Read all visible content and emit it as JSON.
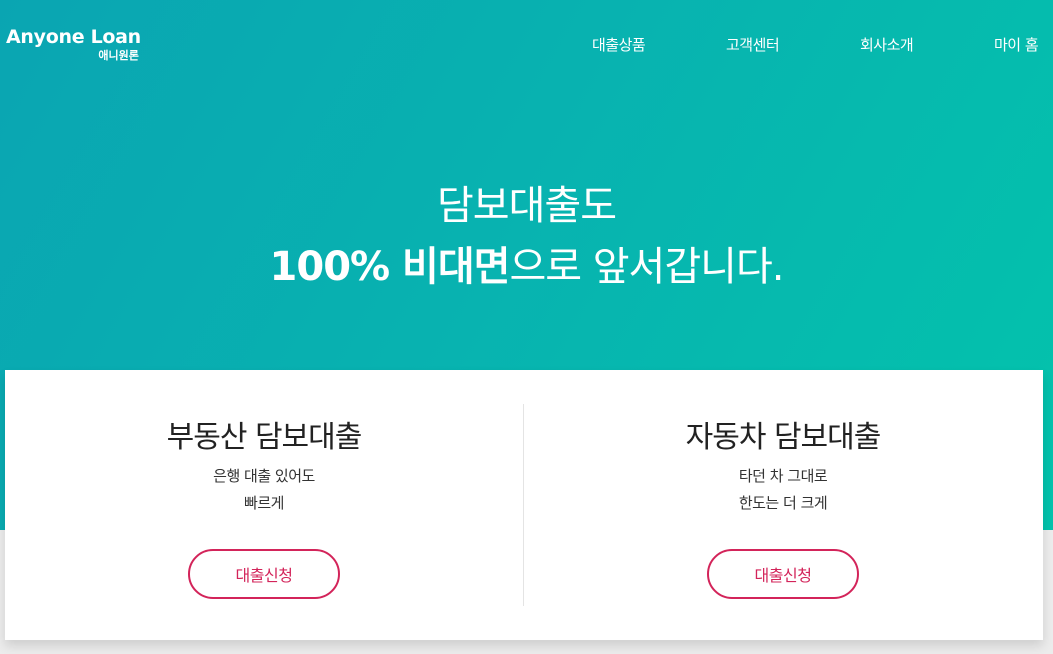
{
  "logo": {
    "name_en": "Anyone Loan",
    "name_ko": "애니원론"
  },
  "nav": {
    "items": [
      {
        "label": "대출상품"
      },
      {
        "label": "고객센터"
      },
      {
        "label": "회사소개"
      },
      {
        "label": "마이 홈"
      }
    ]
  },
  "hero": {
    "line1": "담보대출도",
    "line2_strong": "100% 비대면",
    "line2_rest": "으로 앞서갑니다."
  },
  "products": [
    {
      "title": "부동산 담보대출",
      "desc_line1": "은행 대출 있어도",
      "desc_line2": "빠르게",
      "button": "대출신청"
    },
    {
      "title": "자동차 담보대출",
      "desc_line1": "타던 차 그대로",
      "desc_line2": "한도는 더 크게",
      "button": "대출신청"
    }
  ],
  "colors": {
    "hero_gradient_start": "#0aa5b2",
    "hero_gradient_end": "#03c3ac",
    "accent": "#d3245a"
  }
}
